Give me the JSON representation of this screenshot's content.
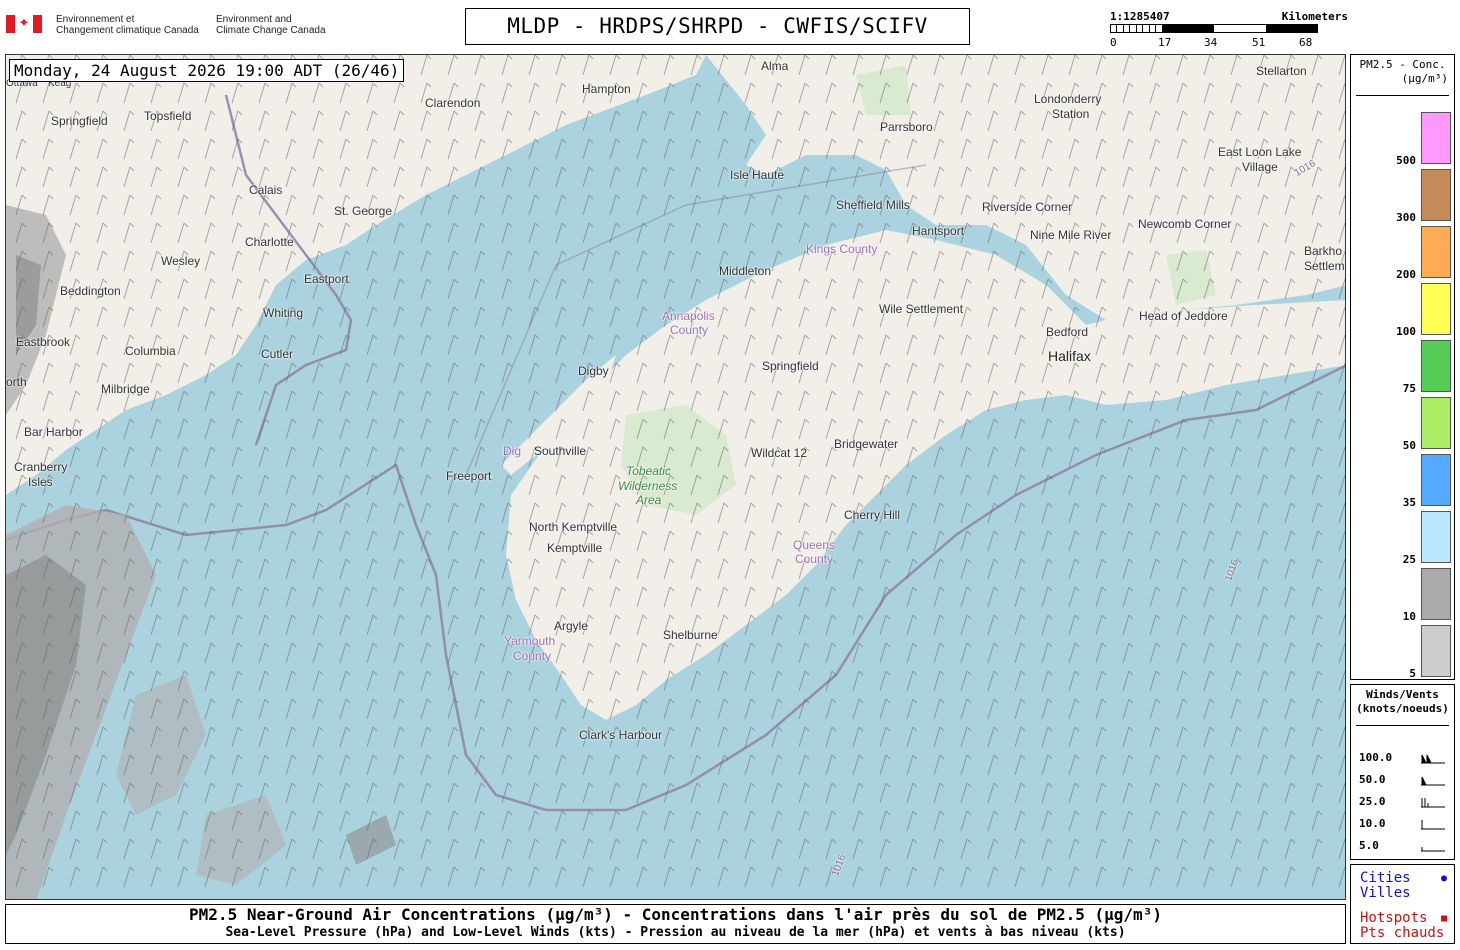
{
  "header": {
    "department_fr": [
      "Environnement et",
      "Changement climatique Canada"
    ],
    "department_en": [
      "Environment and",
      "Climate Change Canada"
    ],
    "title": "MLDP - HRDPS/SHRPD - CWFIS/SCIFV"
  },
  "scale": {
    "ratio": "1:1285407",
    "unit": "Kilometers",
    "ticks": [
      "0",
      "17",
      "34",
      "51",
      "68"
    ]
  },
  "map": {
    "timestamp": "Monday, 24 August 2026 19:00 ADT (26/46)",
    "isobar_labels": [
      "1016",
      "1016",
      "1016"
    ],
    "places": [
      {
        "name": "Alma"
      },
      {
        "name": "Stellarton"
      },
      {
        "name": "Hampton"
      },
      {
        "name": "Clarendon"
      },
      {
        "name": "Springfield"
      },
      {
        "name": "Topsfield"
      },
      {
        "name": "Londonderry"
      },
      {
        "name": "Station"
      },
      {
        "name": "Parrsboro"
      },
      {
        "name": "East Loon Lake"
      },
      {
        "name": "Village"
      },
      {
        "name": "Calais"
      },
      {
        "name": "Isle Haute"
      },
      {
        "name": "St. George"
      },
      {
        "name": "Sheffield Mills"
      },
      {
        "name": "Riverside Corner"
      },
      {
        "name": "Charlotte"
      },
      {
        "name": "Hantsport"
      },
      {
        "name": "Nine Mile River"
      },
      {
        "name": "Newcomb Corner"
      },
      {
        "name": "Wesley"
      },
      {
        "name": "Kings County"
      },
      {
        "name": "Middleton"
      },
      {
        "name": "Eastport"
      },
      {
        "name": "Barkho"
      },
      {
        "name": "Settlem"
      },
      {
        "name": "Beddington"
      },
      {
        "name": "Whiting"
      },
      {
        "name": "Wile Settlement"
      },
      {
        "name": "Annapolis"
      },
      {
        "name": "County"
      },
      {
        "name": "Head of Jeddore"
      },
      {
        "name": "Eastbrook"
      },
      {
        "name": "Bedford"
      },
      {
        "name": "Cutler"
      },
      {
        "name": "Columbia"
      },
      {
        "name": "Halifax"
      },
      {
        "name": "Springfield"
      },
      {
        "name": "Digby"
      },
      {
        "name": "Milbridge"
      },
      {
        "name": "orth"
      },
      {
        "name": "Bar Harbor"
      },
      {
        "name": "Bridgewater"
      },
      {
        "name": "Dig"
      },
      {
        "name": "Southville"
      },
      {
        "name": "Wildcat 12"
      },
      {
        "name": "Cranberry"
      },
      {
        "name": "Isles"
      },
      {
        "name": "Tobeatic"
      },
      {
        "name": "Wilderness"
      },
      {
        "name": "Area"
      },
      {
        "name": "Freeport"
      },
      {
        "name": "Cherry Hill"
      },
      {
        "name": "North Kemptville"
      },
      {
        "name": "Kemptville"
      },
      {
        "name": "Queens"
      },
      {
        "name": "County"
      },
      {
        "name": "Argyle"
      },
      {
        "name": "Yarmouth"
      },
      {
        "name": "County"
      },
      {
        "name": "Shelburne"
      },
      {
        "name": "Clark's Harbour"
      },
      {
        "name": "Ottawa"
      },
      {
        "name": "Keag"
      }
    ]
  },
  "legend_pm": {
    "title": "PM2.5 - Conc.",
    "unit": "(µg/m³)",
    "bins": [
      {
        "label": "500",
        "color": "#ff99ff"
      },
      {
        "label": "300",
        "color": "#c48a58"
      },
      {
        "label": "200",
        "color": "#ffaa55"
      },
      {
        "label": "100",
        "color": "#ffff55"
      },
      {
        "label": "75",
        "color": "#55cc55"
      },
      {
        "label": "50",
        "color": "#aaee66"
      },
      {
        "label": "35",
        "color": "#55aaff"
      },
      {
        "label": "25",
        "color": "#bbe8ff"
      },
      {
        "label": "10",
        "color": "#aaaaaa"
      },
      {
        "label": "5",
        "color": "#cccccc"
      }
    ]
  },
  "legend_wind": {
    "title": "Winds/Vents",
    "unit": "(knots/noeuds)",
    "rows": [
      {
        "label": "100.0",
        "knots": 100
      },
      {
        "label": "50.0",
        "knots": 50
      },
      {
        "label": "25.0",
        "knots": 25
      },
      {
        "label": "10.0",
        "knots": 10
      },
      {
        "label": "5.0",
        "knots": 5
      }
    ]
  },
  "legend_cities": {
    "cities": [
      "Cities",
      "Villes"
    ],
    "hotspots": [
      "Hotspots",
      "Pts chauds"
    ],
    "city_color": "#1111cc",
    "hotspot_color": "#cc1111"
  },
  "footer": {
    "line1": "PM2.5 Near-Ground Air Concentrations (µg/m³) - Concentrations dans l'air près du sol de PM2.5 (µg/m³)",
    "line2": "Sea-Level Pressure (hPa) and Low-Level Winds (kts) - Pression au niveau de la mer (hPa) et vents à bas niveau (kts)"
  },
  "colors": {
    "water": "#aad3df",
    "land": "#f2efe9",
    "isobar": "#8e86a8",
    "barb": "#666666",
    "smoke_light": "#b0b0b0",
    "smoke_dark": "#8e8e8e"
  }
}
